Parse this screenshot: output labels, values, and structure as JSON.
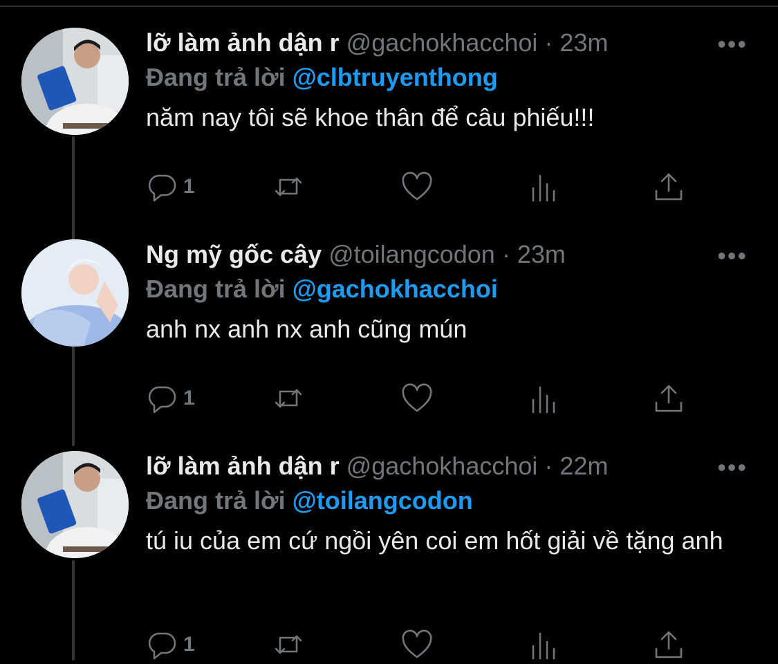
{
  "tweets": [
    {
      "display_name": "lỡ làm ảnh dận r",
      "handle": "@gachokhacchoi",
      "time": "23m",
      "reply_prefix": "Đang trả lời",
      "reply_to": "@clbtruyenthong",
      "text": "năm nay tôi sẽ khoe thân để câu phiếu!!!",
      "reply_count": "1",
      "avatar": "avatar-man-reading-blue-book"
    },
    {
      "display_name": "Ng mỹ gốc cây",
      "handle": "@toilangcodon",
      "time": "23m",
      "reply_prefix": "Đang trả lời",
      "reply_to": "@gachokhacchoi",
      "text": "anh nx anh nx anh cũng mún",
      "reply_count": "1",
      "avatar": "avatar-blonde-man-light-shirt"
    },
    {
      "display_name": "lỡ làm ảnh dận r",
      "handle": "@gachokhacchoi",
      "time": "22m",
      "reply_prefix": "Đang trả lời",
      "reply_to": "@toilangcodon",
      "text": "tú iu của em cứ ngồi yên coi em hốt giải về tặng anh",
      "reply_count": "1",
      "avatar": "avatar-man-reading-blue-book"
    }
  ],
  "separator": "·",
  "more_label": "•••",
  "colors": {
    "background": "#000000",
    "text": "#e7e9ea",
    "muted": "#71767b",
    "link": "#1d9bf0",
    "thread_line": "#333639"
  },
  "icons": [
    "reply-icon",
    "retweet-icon",
    "like-icon",
    "analytics-icon",
    "share-icon"
  ]
}
